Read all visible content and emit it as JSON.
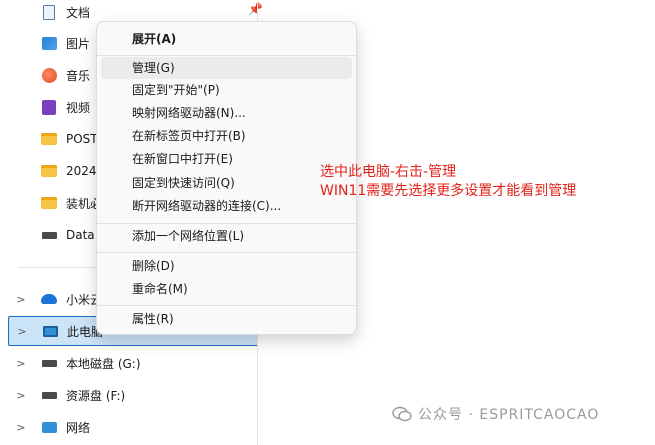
{
  "nav": {
    "items": [
      {
        "label": "文档",
        "icon": "document-icon"
      },
      {
        "label": "图片",
        "icon": "pictures-icon"
      },
      {
        "label": "音乐",
        "icon": "music-icon"
      },
      {
        "label": "视频",
        "icon": "videos-icon"
      },
      {
        "label": "POST",
        "icon": "folder-icon"
      },
      {
        "label": "2024-",
        "icon": "folder-icon"
      },
      {
        "label": "装机必",
        "icon": "folder-icon"
      },
      {
        "label": "Data (",
        "icon": "drive-icon"
      },
      {
        "label": "小米云",
        "icon": "cloud-icon"
      },
      {
        "label": "此电脑",
        "icon": "this-pc-icon"
      },
      {
        "label": "本地磁盘 (G:)",
        "icon": "drive-icon"
      },
      {
        "label": "资源盘 (F:)",
        "icon": "drive-icon"
      },
      {
        "label": "网络",
        "icon": "network-icon"
      }
    ]
  },
  "menu": {
    "items": [
      {
        "label": "展开(A)"
      },
      {
        "label": "管理(G)"
      },
      {
        "label": "固定到\"开始\"(P)"
      },
      {
        "label": "映射网络驱动器(N)..."
      },
      {
        "label": "在新标签页中打开(B)"
      },
      {
        "label": "在新窗口中打开(E)"
      },
      {
        "label": "固定到快速访问(Q)"
      },
      {
        "label": "断开网络驱动器的连接(C)..."
      },
      {
        "label": "添加一个网络位置(L)"
      },
      {
        "label": "删除(D)"
      },
      {
        "label": "重命名(M)"
      },
      {
        "label": "属性(R)"
      }
    ]
  },
  "annotation": {
    "line1": "选中此电脑-右击-管理",
    "line2": "WIN11需要先选择更多设置才能看到管理",
    "color": "#e2231a"
  },
  "watermark": {
    "text": "公众号 · ESPRITCAOCAO"
  },
  "colors": {
    "selection": "#cce4f7",
    "selection_border": "#1c6fc0"
  }
}
